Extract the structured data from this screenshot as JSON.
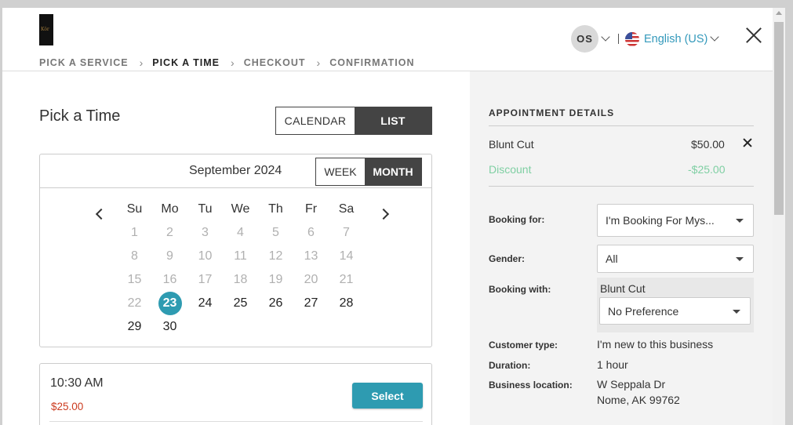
{
  "logo": {
    "text": "Kôr"
  },
  "steps": [
    {
      "label": "PICK A SERVICE",
      "active": false
    },
    {
      "label": "PICK A TIME",
      "active": true
    },
    {
      "label": "CHECKOUT",
      "active": false
    },
    {
      "label": "CONFIRMATION",
      "active": false
    }
  ],
  "header": {
    "avatar_initials": "OS",
    "language": "English (US)"
  },
  "left": {
    "title": "Pick a Time",
    "view_toggle": {
      "calendar": "CALENDAR",
      "list": "LIST",
      "selected": "LIST"
    },
    "calendar": {
      "month": "September 2024",
      "range_toggle": {
        "week": "WEEK",
        "month": "MONTH",
        "selected": "MONTH"
      },
      "weekdays": [
        "Su",
        "Mo",
        "Tu",
        "We",
        "Th",
        "Fr",
        "Sa"
      ],
      "weeks": [
        [
          {
            "d": "1",
            "s": "disabled"
          },
          {
            "d": "2",
            "s": "disabled"
          },
          {
            "d": "3",
            "s": "disabled"
          },
          {
            "d": "4",
            "s": "disabled"
          },
          {
            "d": "5",
            "s": "disabled"
          },
          {
            "d": "6",
            "s": "disabled"
          },
          {
            "d": "7",
            "s": "disabled"
          }
        ],
        [
          {
            "d": "8",
            "s": "disabled"
          },
          {
            "d": "9",
            "s": "disabled"
          },
          {
            "d": "10",
            "s": "disabled"
          },
          {
            "d": "11",
            "s": "disabled"
          },
          {
            "d": "12",
            "s": "disabled"
          },
          {
            "d": "13",
            "s": "disabled"
          },
          {
            "d": "14",
            "s": "disabled"
          }
        ],
        [
          {
            "d": "15",
            "s": "disabled"
          },
          {
            "d": "16",
            "s": "disabled"
          },
          {
            "d": "17",
            "s": "disabled"
          },
          {
            "d": "18",
            "s": "disabled"
          },
          {
            "d": "19",
            "s": "disabled"
          },
          {
            "d": "20",
            "s": "disabled"
          },
          {
            "d": "21",
            "s": "disabled"
          }
        ],
        [
          {
            "d": "22",
            "s": "disabled"
          },
          {
            "d": "23",
            "s": "selected"
          },
          {
            "d": "24",
            "s": "available"
          },
          {
            "d": "25",
            "s": "available"
          },
          {
            "d": "26",
            "s": "available"
          },
          {
            "d": "27",
            "s": "available"
          },
          {
            "d": "28",
            "s": "available"
          }
        ],
        [
          {
            "d": "29",
            "s": "available"
          },
          {
            "d": "30",
            "s": "available"
          }
        ]
      ]
    },
    "slot": {
      "time": "10:30 AM",
      "price": "$25.00",
      "button": "Select"
    }
  },
  "details": {
    "title": "APPOINTMENT DETAILS",
    "service": {
      "name": "Blunt Cut",
      "price": "$50.00"
    },
    "discount": {
      "label": "Discount",
      "value": "-$25.00"
    },
    "booking_for": {
      "label": "Booking for:",
      "value": "I'm Booking For Mys..."
    },
    "gender": {
      "label": "Gender:",
      "value": "All"
    },
    "booking_with": {
      "label": "Booking with:",
      "service": "Blunt Cut",
      "value": "No Preference"
    },
    "customer_type": {
      "label": "Customer type:",
      "value": "I'm new to this business"
    },
    "duration": {
      "label": "Duration:",
      "value": "1 hour"
    },
    "location": {
      "label": "Business location:",
      "line1": "W Seppala Dr",
      "line2": "Nome, AK 99762"
    }
  },
  "colors": {
    "accent": "#2e9bb1",
    "price_red": "#cc3b1f",
    "discount_green": "#7fcfa3",
    "link_blue": "#3399bb"
  }
}
